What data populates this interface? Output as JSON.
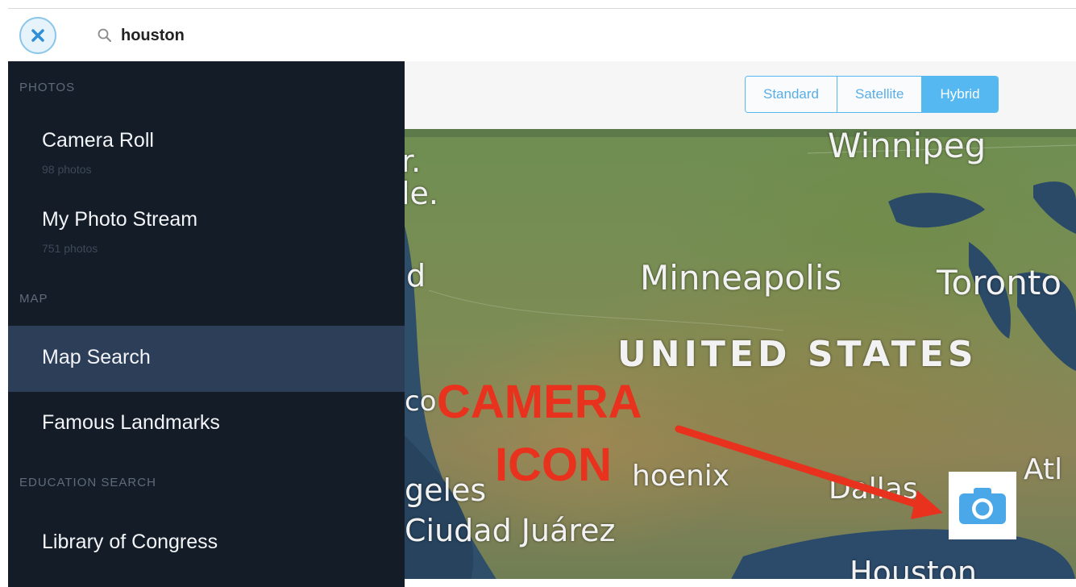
{
  "search": {
    "value": "houston"
  },
  "map_types": {
    "standard": "Standard",
    "satellite": "Satellite",
    "hybrid": "Hybrid",
    "selected": "Hybrid"
  },
  "sidebar": {
    "photos_header": "PHOTOS",
    "camera_roll": {
      "label": "Camera Roll",
      "count": "98 photos"
    },
    "photo_stream": {
      "label": "My Photo Stream",
      "count": "751 photos"
    },
    "map_header": "MAP",
    "map_search": "Map Search",
    "famous_landmarks": "Famous Landmarks",
    "education_header": "EDUCATION SEARCH",
    "library_of_congress": "Library of Congress"
  },
  "map_labels": {
    "winnipeg": "Winnipeg",
    "minneapolis": "Minneapolis",
    "toronto": "Toronto",
    "united_states": "UNITED STATES",
    "phoenix": "hoenix",
    "dallas": "Dallas",
    "atlanta": "Atl",
    "los_angeles": "geles",
    "ciudad_juarez": "Ciudad Juárez",
    "houston": "Houston",
    "edge_r": "r.",
    "edge_le": "le.",
    "edge_d": "d",
    "edge_co": "co"
  },
  "annotation": {
    "line1": "CAMERA",
    "line2": "ICON"
  },
  "icons": {
    "close": "close-icon",
    "search": "search-icon",
    "camera": "camera-icon"
  },
  "colors": {
    "sidebar_bg": "#141c28",
    "active_item": "#2c3e58",
    "accent": "#56b8f0",
    "annotation": "#e8321e"
  }
}
